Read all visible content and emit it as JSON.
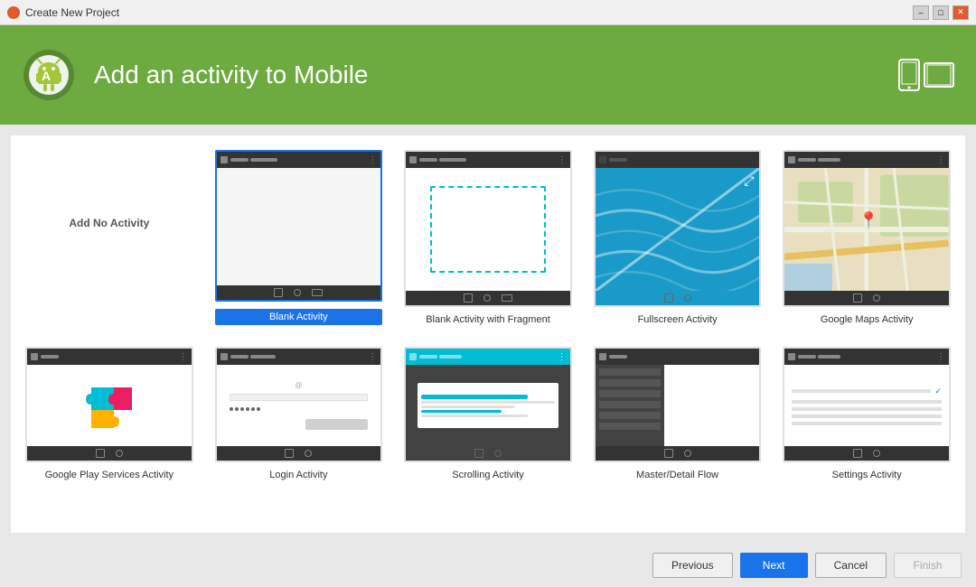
{
  "window": {
    "title": "Create New Project",
    "close_label": "✕",
    "min_label": "–",
    "max_label": "□"
  },
  "header": {
    "title": "Add an activity to Mobile",
    "logo_alt": "Android Studio Logo"
  },
  "activities": [
    {
      "id": "add-no-activity",
      "label": "Add No Activity",
      "selected": false,
      "type": "none"
    },
    {
      "id": "blank-activity",
      "label": "Blank Activity",
      "selected": true,
      "type": "blank"
    },
    {
      "id": "blank-fragment",
      "label": "Blank Activity with Fragment",
      "selected": false,
      "type": "fragment"
    },
    {
      "id": "fullscreen-activity",
      "label": "Fullscreen Activity",
      "selected": false,
      "type": "fullscreen"
    },
    {
      "id": "google-maps-activity",
      "label": "Google Maps Activity",
      "selected": false,
      "type": "maps"
    },
    {
      "id": "google-play-activity",
      "label": "Google Play Services Activity",
      "selected": false,
      "type": "play"
    },
    {
      "id": "login-activity",
      "label": "Login Activity",
      "selected": false,
      "type": "login"
    },
    {
      "id": "scrolling-activity",
      "label": "Scrolling Activity",
      "selected": false,
      "type": "scroll"
    },
    {
      "id": "master-detail",
      "label": "Master/Detail Flow",
      "selected": false,
      "type": "master"
    },
    {
      "id": "settings-activity",
      "label": "Settings Activity",
      "selected": false,
      "type": "settings"
    }
  ],
  "buttons": {
    "previous": "Previous",
    "next": "Next",
    "cancel": "Cancel",
    "finish": "Finish"
  },
  "colors": {
    "header_bg": "#6daa3f",
    "selected_blue": "#1a73e8",
    "title_bar_bg": "#f0f0f0",
    "close_btn": "#e05a2b"
  }
}
